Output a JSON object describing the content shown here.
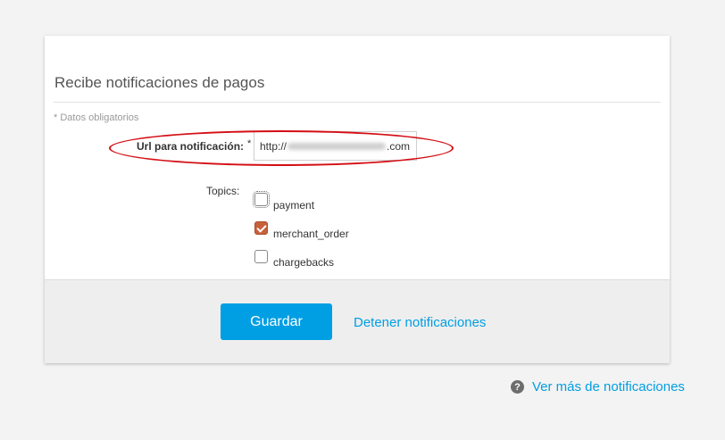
{
  "card": {
    "title": "Recibe notificaciones de pagos",
    "required_note": "* Datos obligatorios"
  },
  "url_field": {
    "label": "Url para notificación:",
    "required_mark": "*",
    "value_prefix": "http://",
    "value_suffix": ".com"
  },
  "topics": {
    "label": "Topics:",
    "items": [
      {
        "label": "payment",
        "checked": false
      },
      {
        "label": "merchant_order",
        "checked": true
      },
      {
        "label": "chargebacks",
        "checked": false
      }
    ]
  },
  "footer": {
    "save_label": "Guardar",
    "stop_label": "Detener notificaciones"
  },
  "more_link": {
    "icon": "help-circle-icon",
    "label": "Ver más de notificaciones"
  },
  "colors": {
    "accent": "#009ee3",
    "checkbox_checked": "#c8613a",
    "highlight": "#d40e14"
  }
}
